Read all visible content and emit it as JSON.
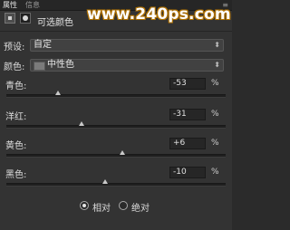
{
  "tabs": [
    {
      "label": "属性",
      "active": true
    },
    {
      "label": "信息",
      "active": false
    }
  ],
  "watermark": "www.240ps.com",
  "panel_title": "可选颜色",
  "preset": {
    "label": "预设:",
    "value": "自定"
  },
  "colors": {
    "label": "颜色:",
    "value": "中性色",
    "swatch": "#7b7b7b"
  },
  "sliders": [
    {
      "label": "青色:",
      "value": "-53",
      "unit": "%",
      "level": -53
    },
    {
      "label": "洋红:",
      "value": "-31",
      "unit": "%",
      "level": -31
    },
    {
      "label": "黄色:",
      "value": "+6",
      "unit": "%",
      "level": 6
    },
    {
      "label": "黑色:",
      "value": "-10",
      "unit": "%",
      "level": -10
    }
  ],
  "method": {
    "options": [
      {
        "label": "相对",
        "checked": true
      },
      {
        "label": "绝对",
        "checked": false
      }
    ]
  }
}
